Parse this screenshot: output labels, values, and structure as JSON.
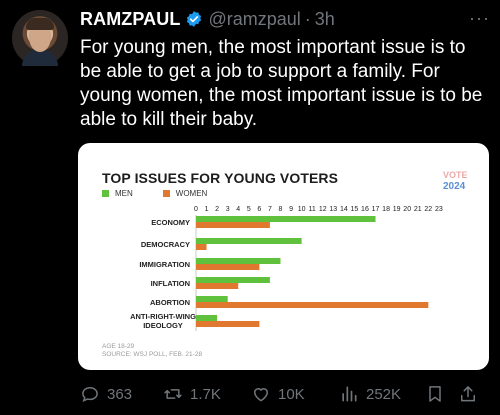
{
  "tweet": {
    "display_name": "RAMZPAUL",
    "handle": "@ramzpaul",
    "separator": "·",
    "time": "3h",
    "more": "···",
    "text": "For young men, the most important issue is to be able to get a job to support a family. For young women, the most important issue is to be able to kill their baby."
  },
  "card": {
    "logo_text": "2024",
    "logo_subtext": "VOTE",
    "footnote_1": "AGE 18-29",
    "footnote_2": "SOURCE: WSJ POLL, FEB. 21-28"
  },
  "chart_data": {
    "type": "bar",
    "orientation": "horizontal",
    "title": "TOP ISSUES FOR YOUNG VOTERS",
    "categories": [
      "ECONOMY",
      "DEMOCRACY",
      "IMMIGRATION",
      "INFLATION",
      "ABORTION",
      "ANTI-RIGHT-WING IDEOLOGY"
    ],
    "series": [
      {
        "name": "MEN",
        "color": "#5fc13c",
        "values": [
          17,
          10,
          8,
          7,
          3,
          2
        ]
      },
      {
        "name": "WOMEN",
        "color": "#e0782f",
        "values": [
          7,
          1,
          6,
          4,
          22,
          6
        ]
      }
    ],
    "xlim": [
      0,
      23
    ],
    "x_ticks": [
      0,
      1,
      2,
      3,
      4,
      5,
      6,
      7,
      8,
      9,
      10,
      11,
      12,
      13,
      14,
      15,
      16,
      17,
      18,
      19,
      20,
      21,
      22,
      23
    ],
    "legend_position": "top-left",
    "grid": false
  },
  "actions": {
    "replies": "363",
    "retweets": "1.7K",
    "likes": "10K",
    "views": "252K"
  },
  "colors": {
    "background": "#000000",
    "text": "#e7e9ea",
    "muted": "#71767b",
    "verified": "#1d9bf0"
  }
}
